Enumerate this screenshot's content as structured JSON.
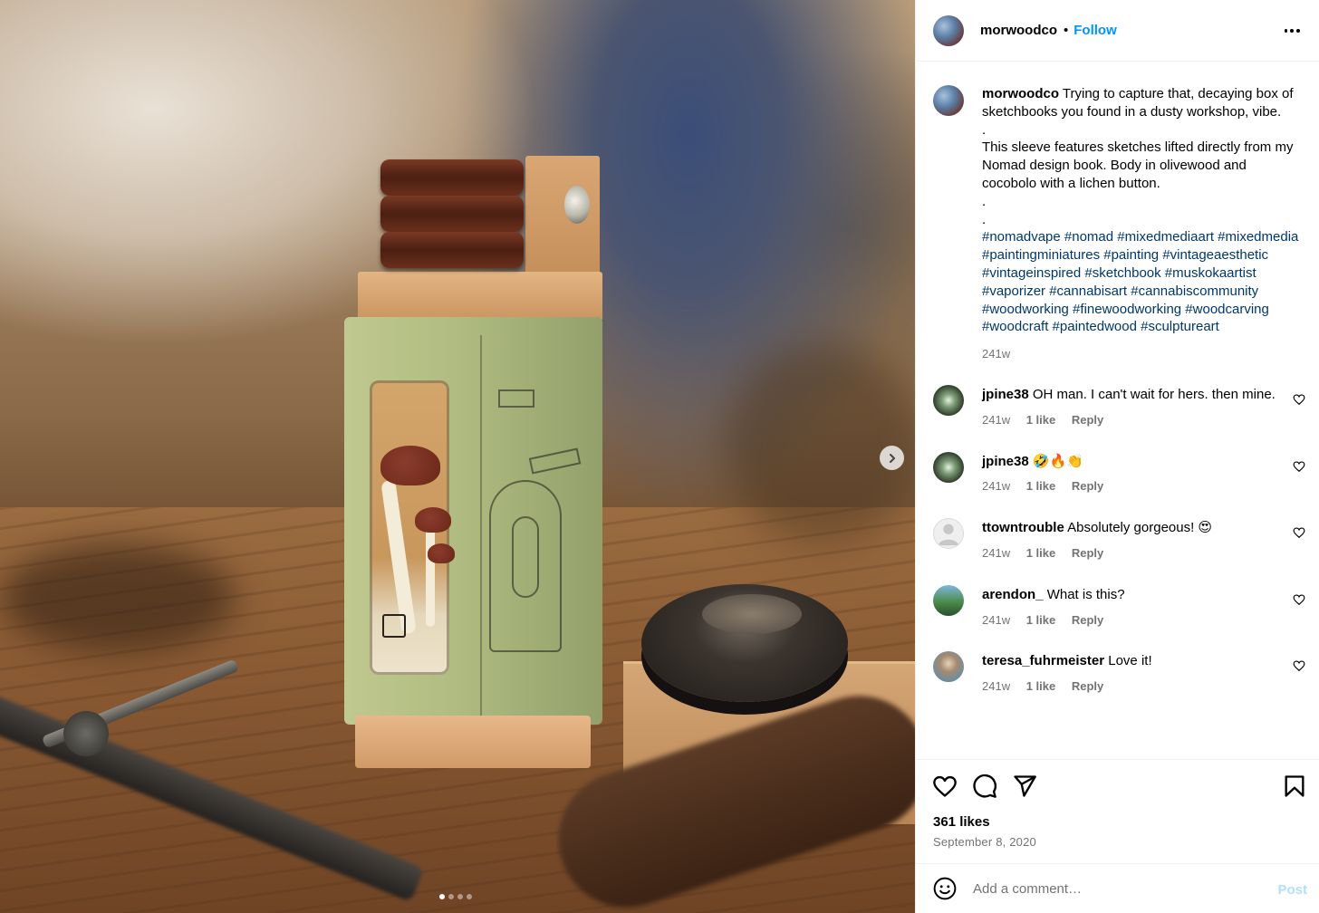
{
  "post": {
    "image_alt": "",
    "carousel_dots": 4,
    "carousel_active": 0
  },
  "header": {
    "username": "morwoodco",
    "separator": "•",
    "follow_label": "Follow"
  },
  "caption": {
    "username": "morwoodco",
    "text": "Trying to capture that, decaying box of sketchbooks you found in a dusty workshop, vibe.\n.\nThis sleeve features sketches lifted directly from my Nomad design book. Body in olivewood and cocobolo with a lichen button.\n.\n.",
    "hashtags": "#nomadvape #nomad #mixedmediaart #mixedmedia #paintingminiatures #painting #vintageaesthetic #vintageinspired #sketchbook #muskokaartist #vaporizer #cannabisart #cannabiscommunity #woodworking #finewoodworking #woodcarving #woodcraft #paintedwood #sculptureart",
    "time": "241w"
  },
  "comments": [
    {
      "username": "jpine38",
      "text": "OH man. I can't wait for hers. then mine.",
      "time": "241w",
      "likes": "1 like",
      "reply": "Reply"
    },
    {
      "username": "jpine38",
      "text": "🤣🔥👏",
      "time": "241w",
      "likes": "1 like",
      "reply": "Reply"
    },
    {
      "username": "ttowntrouble",
      "text": "Absolutely gorgeous! 😍",
      "time": "241w",
      "likes": "1 like",
      "reply": "Reply"
    },
    {
      "username": "arendon_",
      "text": "What is this?",
      "time": "241w",
      "likes": "1 like",
      "reply": "Reply"
    },
    {
      "username": "teresa_fuhrmeister",
      "text": "Love it!",
      "time": "241w",
      "likes": "1 like",
      "reply": "Reply"
    }
  ],
  "footer": {
    "likes": "361 likes",
    "date": "September 8, 2020",
    "comment_placeholder": "Add a comment…",
    "post_label": "Post"
  },
  "colors": {
    "link": "#0095f6",
    "hashtag": "#00376b",
    "muted": "#737373"
  }
}
